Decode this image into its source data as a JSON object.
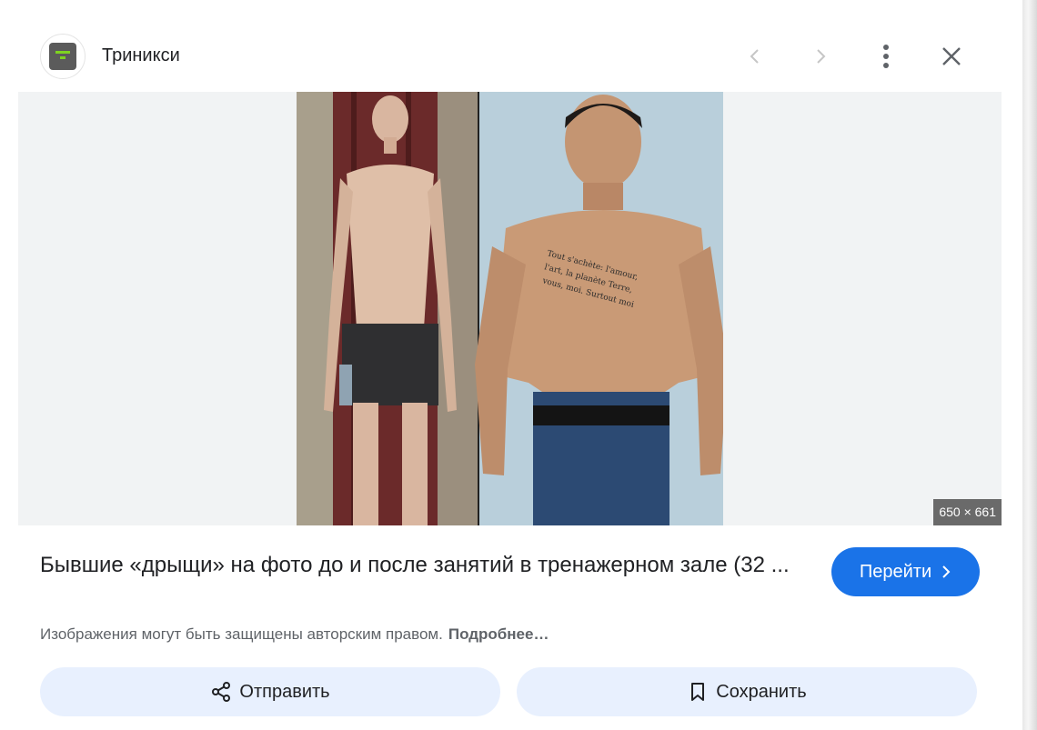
{
  "header": {
    "site_name": "Триникси",
    "prev_icon": "chevron-left-icon",
    "next_icon": "chevron-right-icon",
    "more_icon": "more-vert-icon",
    "close_icon": "close-icon"
  },
  "image": {
    "dimensions": "650 × 661"
  },
  "result": {
    "title": "Бывшие «дрыщи» на фото до и после занятий в тренажерном зале (32 ...",
    "visit_label": "Перейти",
    "copyright_text": "Изображения могут быть защищены авторским правом.",
    "learn_more": "Подробнее…"
  },
  "actions": {
    "share_label": "Отправить",
    "save_label": "Сохранить"
  },
  "colors": {
    "primary_button": "#1a73e8",
    "secondary_button": "#e8f0fe",
    "image_background": "#f1f3f4"
  }
}
